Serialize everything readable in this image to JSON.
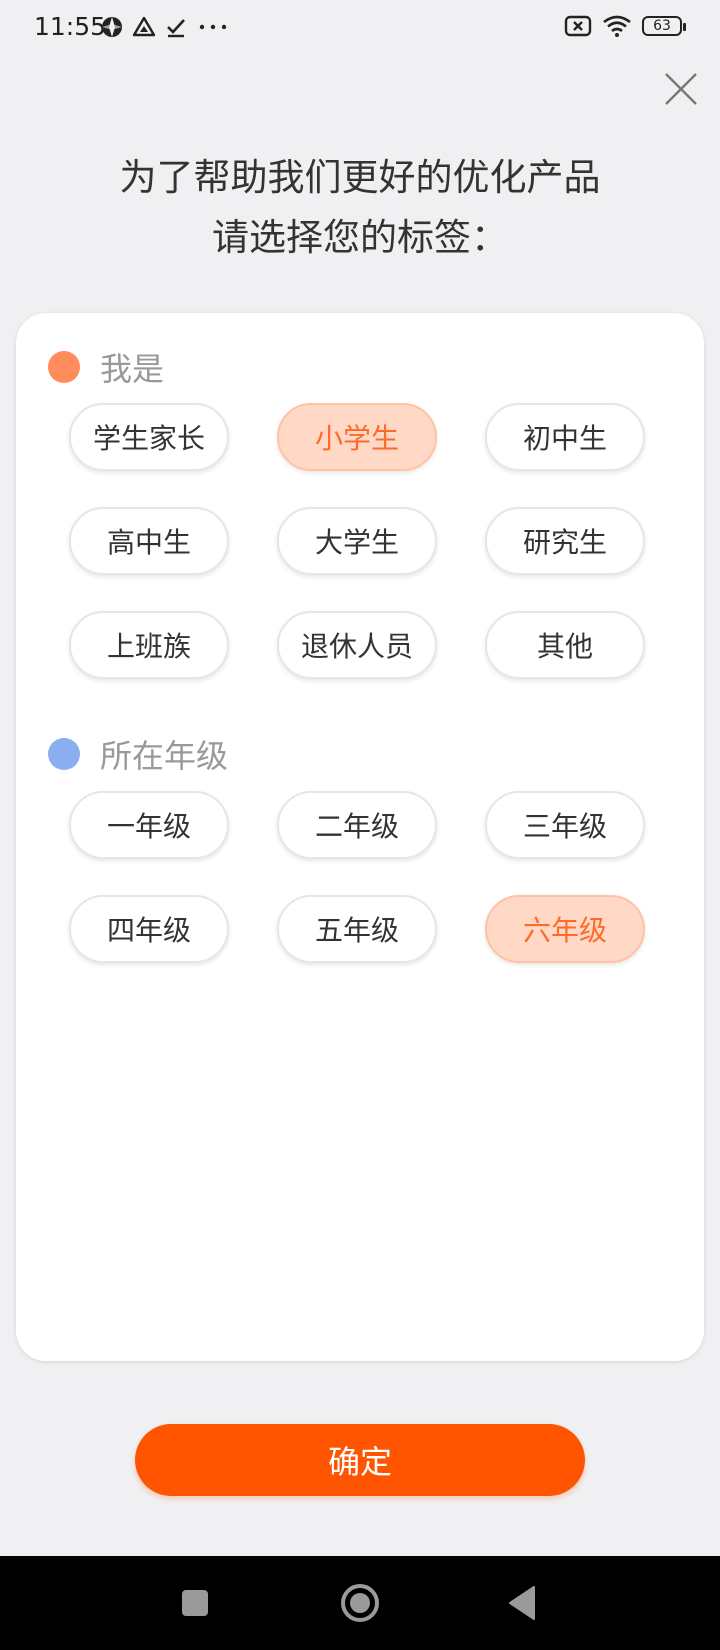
{
  "status_bar": {
    "time": "11:55",
    "battery": "63",
    "left_icons": [
      "vpn-icon",
      "drive-icon",
      "check-icon",
      "more-dots-icon"
    ],
    "right_icons": [
      "no-sim-icon",
      "wifi-icon",
      "battery-icon"
    ]
  },
  "title": {
    "line1": "为了帮助我们更好的优化产品",
    "line2": "请选择您的标签："
  },
  "sections": {
    "identity": {
      "label": "我是",
      "dot_color": "#ff8c5a",
      "options": [
        "学生家长",
        "小学生",
        "初中生",
        "高中生",
        "大学生",
        "研究生",
        "上班族",
        "退休人员",
        "其他"
      ],
      "selected": "小学生"
    },
    "grade": {
      "label": "所在年级",
      "dot_color": "#8aaef0",
      "options": [
        "一年级",
        "二年级",
        "三年级",
        "四年级",
        "五年级",
        "六年级"
      ],
      "selected": "六年级"
    }
  },
  "confirm_label": "确定",
  "colors": {
    "accent": "#ff5500",
    "selected_bg": "#ffd9c6",
    "selected_text": "#ff6a2a"
  }
}
